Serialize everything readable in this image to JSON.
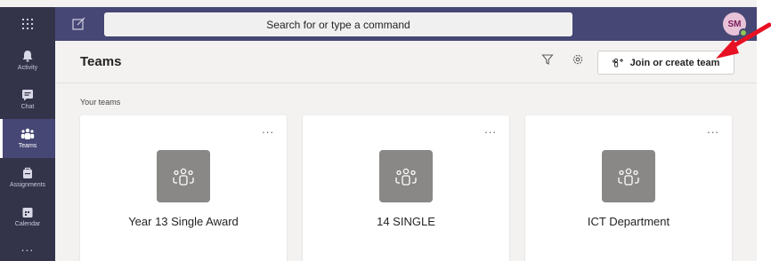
{
  "topbar": {
    "search_placeholder": "Search for or type a command",
    "avatar_initials": "SM",
    "presence_color": "#92c353",
    "waffle_icon": "app-launcher-icon",
    "compose_icon": "compose-icon"
  },
  "rail": {
    "items": [
      {
        "label": "Activity",
        "icon": "bell-icon"
      },
      {
        "label": "Chat",
        "icon": "chat-icon"
      },
      {
        "label": "Teams",
        "icon": "teams-icon",
        "active": true
      },
      {
        "label": "Assignments",
        "icon": "assignments-icon"
      },
      {
        "label": "Calendar",
        "icon": "calendar-icon"
      }
    ],
    "more_label": "..."
  },
  "header": {
    "title": "Teams",
    "join_label": "Join or create team"
  },
  "section": {
    "label": "Your teams"
  },
  "teams": [
    {
      "name": "Year 13 Single Award",
      "more": "..."
    },
    {
      "name": "14 SINGLE",
      "more": "..."
    },
    {
      "name": "ICT Department",
      "more": "..."
    }
  ],
  "colors": {
    "topbar": "#464775",
    "rail": "#33344a",
    "tile": "#8a8886",
    "annotation_arrow": "#e81123"
  }
}
